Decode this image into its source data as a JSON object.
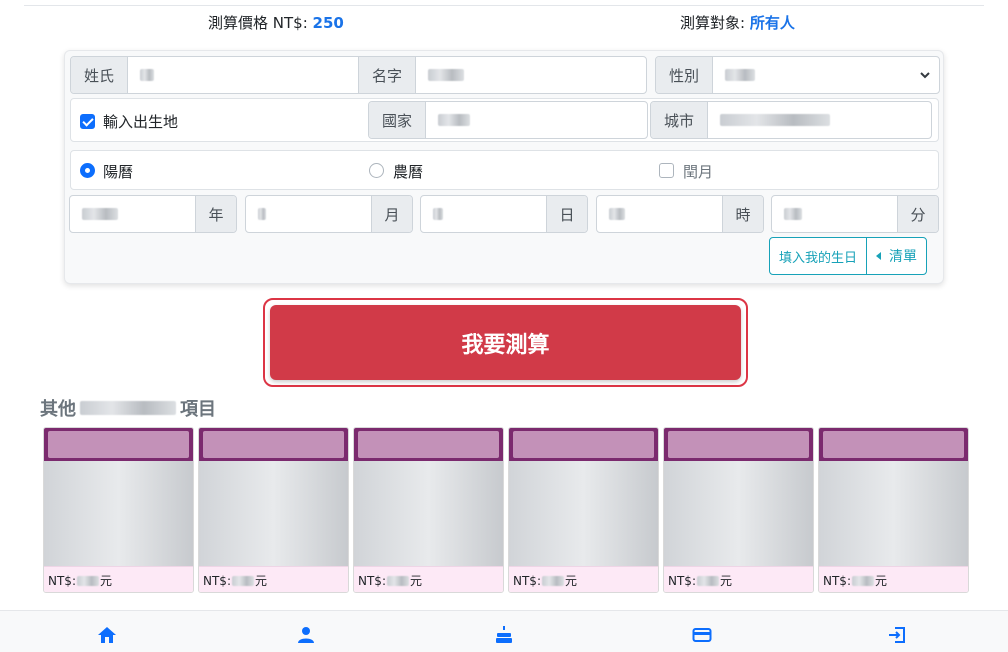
{
  "price_bar": {
    "price_label": "測算價格 NT$:",
    "price_value": "250",
    "target_label": "測算對象:",
    "target_value": "所有人"
  },
  "form": {
    "surname": {
      "label": "姓氏",
      "value": ""
    },
    "given_name": {
      "label": "名字",
      "value": ""
    },
    "gender": {
      "label": "性別",
      "value": ""
    },
    "birthplace_checkbox": {
      "label": "輸入出生地",
      "checked": true
    },
    "country": {
      "label": "國家",
      "value": ""
    },
    "city": {
      "label": "城市",
      "value": ""
    },
    "calendar_options": [
      {
        "label": "陽曆",
        "selected": true
      },
      {
        "label": "農曆",
        "selected": false
      }
    ],
    "leap_month": {
      "label": "閏月",
      "checked": false
    },
    "date_units": [
      "年",
      "月",
      "日",
      "時",
      "分"
    ],
    "fill_my_birthday": "填入我的生日",
    "list_button": "清單"
  },
  "submit_label": "我要測算",
  "other_section": {
    "title_prefix": "其他",
    "title_suffix": "項目"
  },
  "products": [
    {
      "price_prefix": "NT$:",
      "price_suffix": "元"
    },
    {
      "price_prefix": "NT$:",
      "price_suffix": "元"
    },
    {
      "price_prefix": "NT$:",
      "price_suffix": "元"
    },
    {
      "price_prefix": "NT$:",
      "price_suffix": "元"
    },
    {
      "price_prefix": "NT$:",
      "price_suffix": "元"
    },
    {
      "price_prefix": "NT$:",
      "price_suffix": "元"
    }
  ],
  "footer_nav": [
    "home-icon",
    "person-icon",
    "cake-icon",
    "card-icon",
    "logout-icon"
  ],
  "colors": {
    "accent": "#1a73e8",
    "submit": "#d13a48",
    "product_header": "#7b2a6e",
    "nav_icon": "#0d6efd"
  }
}
